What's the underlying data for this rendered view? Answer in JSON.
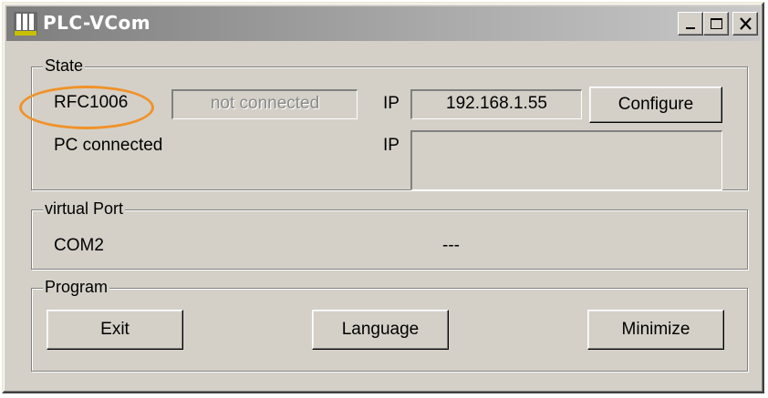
{
  "window": {
    "title": "PLC-VCom",
    "accent_color": "#f0922a",
    "icons": [
      "app-logo-icon",
      "minimize-icon",
      "maximize-icon",
      "close-icon"
    ]
  },
  "state": {
    "group_label": "State",
    "rfc_label": "RFC1006",
    "rfc_status": "not connected",
    "ip_label": "IP",
    "ip_value": "192.168.1.55",
    "configure_label": "Configure",
    "pc_connected_label": "PC connected",
    "pc_ip_label": "IP",
    "pc_ip_value": ""
  },
  "virtual_port": {
    "group_label": "virtual Port",
    "port_name": "COM2",
    "port_status": "---"
  },
  "program": {
    "group_label": "Program",
    "exit_label": "Exit",
    "language_label": "Language",
    "minimize_label": "Minimize"
  }
}
